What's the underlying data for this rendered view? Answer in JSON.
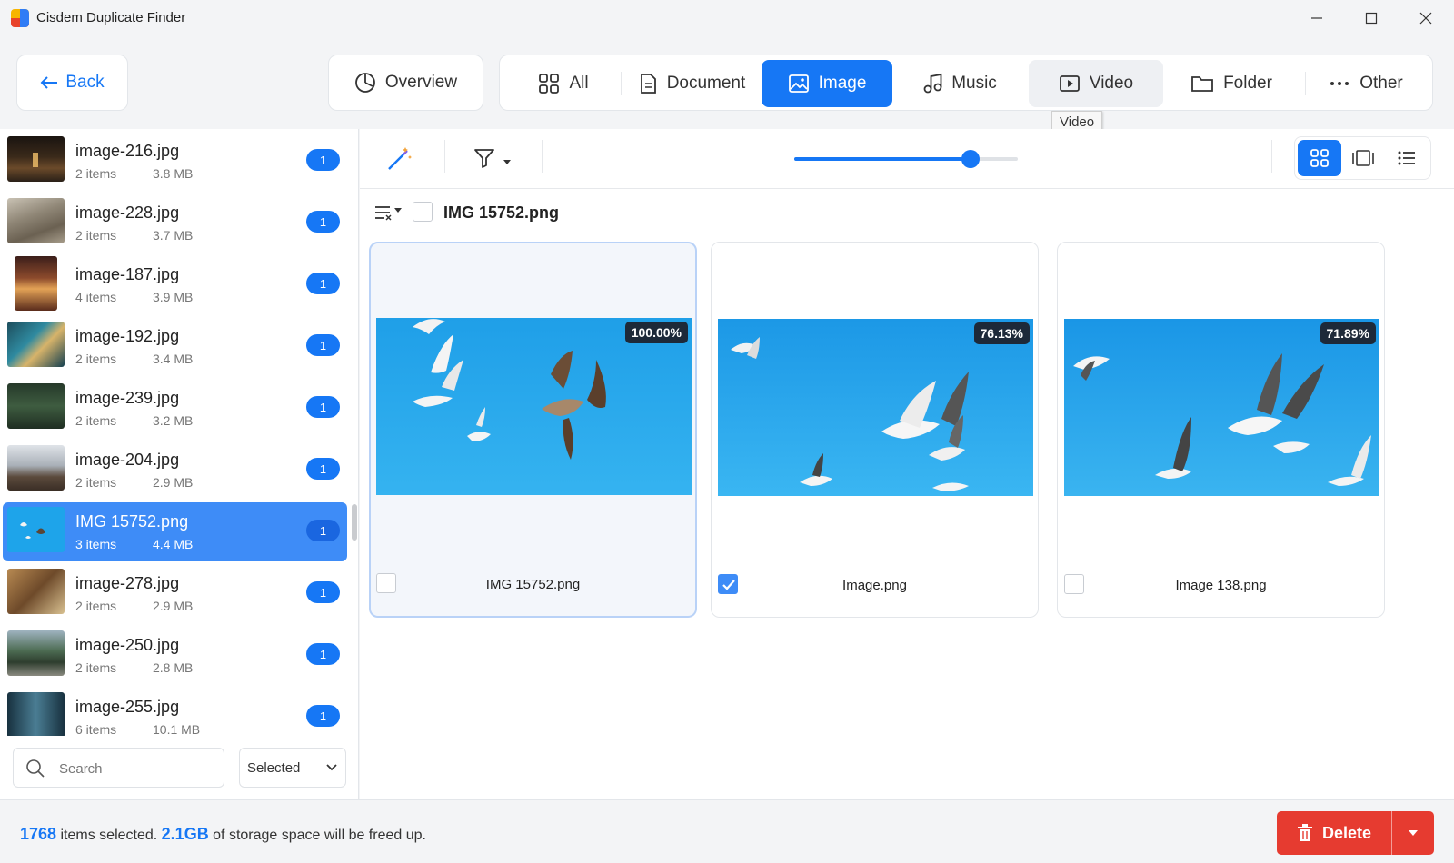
{
  "window": {
    "title": "Cisdem Duplicate Finder",
    "controls": [
      "minimize",
      "maximize",
      "close"
    ]
  },
  "toolbar": {
    "back_label": "Back",
    "overview_label": "Overview",
    "tabs": [
      {
        "label": "All",
        "icon": "grid-icon"
      },
      {
        "label": "Document",
        "icon": "document-icon"
      },
      {
        "label": "Image",
        "icon": "image-icon",
        "active": true
      },
      {
        "label": "Music",
        "icon": "music-icon"
      },
      {
        "label": "Video",
        "icon": "video-icon"
      },
      {
        "label": "Folder",
        "icon": "folder-icon"
      },
      {
        "label": "Other",
        "icon": "more-icon"
      }
    ],
    "tooltip": "Video"
  },
  "sidebar": {
    "items": [
      {
        "name": "image-216.jpg",
        "count": "2 items",
        "size": "3.8 MB",
        "badge": "1"
      },
      {
        "name": "image-228.jpg",
        "count": "2 items",
        "size": "3.7 MB",
        "badge": "1"
      },
      {
        "name": "image-187.jpg",
        "count": "4 items",
        "size": "3.9 MB",
        "badge": "1"
      },
      {
        "name": "image-192.jpg",
        "count": "2 items",
        "size": "3.4 MB",
        "badge": "1"
      },
      {
        "name": "image-239.jpg",
        "count": "2 items",
        "size": "3.2 MB",
        "badge": "1"
      },
      {
        "name": "image-204.jpg",
        "count": "2 items",
        "size": "2.9 MB",
        "badge": "1"
      },
      {
        "name": "IMG 15752.png",
        "count": "3 items",
        "size": "4.4 MB",
        "badge": "1",
        "selected": true
      },
      {
        "name": "image-278.jpg",
        "count": "2 items",
        "size": "2.9 MB",
        "badge": "1"
      },
      {
        "name": "image-250.jpg",
        "count": "2 items",
        "size": "2.8 MB",
        "badge": "1"
      },
      {
        "name": "image-255.jpg",
        "count": "6 items",
        "size": "10.1 MB",
        "badge": "1"
      }
    ],
    "search_placeholder": "Search",
    "filter_select": "Selected"
  },
  "main": {
    "zoom_level": 0.79,
    "view_modes": [
      "thumbnail-grid-icon",
      "carousel-icon",
      "list-icon"
    ],
    "group_title": "IMG 15752.png",
    "cards": [
      {
        "name": "IMG 15752.png",
        "similarity": "100.00%",
        "checked": false
      },
      {
        "name": "Image.png",
        "similarity": "76.13%",
        "checked": true
      },
      {
        "name": "Image 138.png",
        "similarity": "71.89%",
        "checked": false
      }
    ]
  },
  "status": {
    "selected_count": "1768",
    "selected_text": "items selected.",
    "freed_size": "2.1GB",
    "freed_text": "of storage space will be freed up.",
    "delete_label": "Delete"
  },
  "colors": {
    "accent": "#1677f5",
    "delete": "#e63b30",
    "sky": "#1ea4ea"
  }
}
